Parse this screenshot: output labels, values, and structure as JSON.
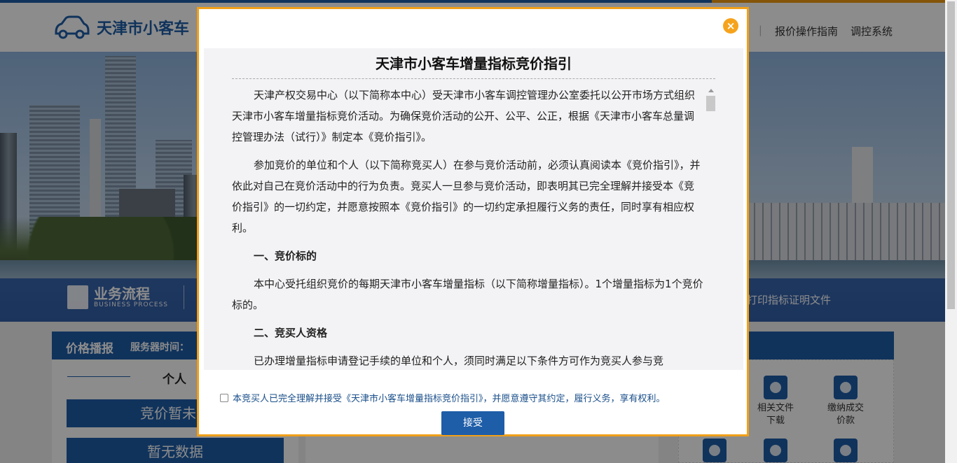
{
  "header": {
    "site_title": "天津市小客车",
    "nav": [
      "报价操作指南",
      "调控系统"
    ]
  },
  "banner": {
    "process_title": "业务流程",
    "process_subtitle": "BUSINESS PROCESS",
    "print_link": "打印指标证明文件"
  },
  "price_bar": {
    "title": "价格播报",
    "server_time_label": "服务器时间：",
    "tab_individual": "个人",
    "auction_status": "竞价暂未开",
    "no_data": "暂无数据"
  },
  "services": [
    {
      "label1": "相关文件",
      "label2": "下载",
      "icon": "download-icon"
    },
    {
      "label1": "缴纳成交",
      "label2": "价款",
      "icon": "payment-icon"
    }
  ],
  "modal": {
    "close_label": "×",
    "title": "天津市小客车增量指标竞价指引",
    "paragraphs": [
      "天津产权交易中心（以下简称本中心）受天津市小客车调控管理办公室委托以公开市场方式组织天津市小客车增量指标竞价活动。为确保竞价活动的公开、公平、公正，根据《天津市小客车总量调控管理办法（试行）》制定本《竞价指引》。",
      "参加竞价的单位和个人（以下简称竞买人）在参与竞价活动前，必须认真阅读本《竞价指引》，并依此对自己在竞价活动中的行为负责。竞买人一旦参与竞价活动，即表明其已完全理解并接受本《竞价指引》的一切约定，并愿意按照本《竞价指引》的一切约定承担履行义务的责任，同时享有相应权利。",
      "一、竞价标的",
      "本中心受托组织竞价的每期天津市小客车增量指标（以下简称增量指标）。1个增量指标为1个竞价标的。",
      "二、竞买人资格",
      "已办理增量指标申请登记手续的单位和个人，须同时满足以下条件方可作为竞买人参与竞"
    ],
    "agree_text": "本竞买人已完全理解并接受《天津市小客车增量指标竞价指引》，并愿意遵守其约定，履行义务，享有权利。",
    "accept_label": "接受"
  }
}
